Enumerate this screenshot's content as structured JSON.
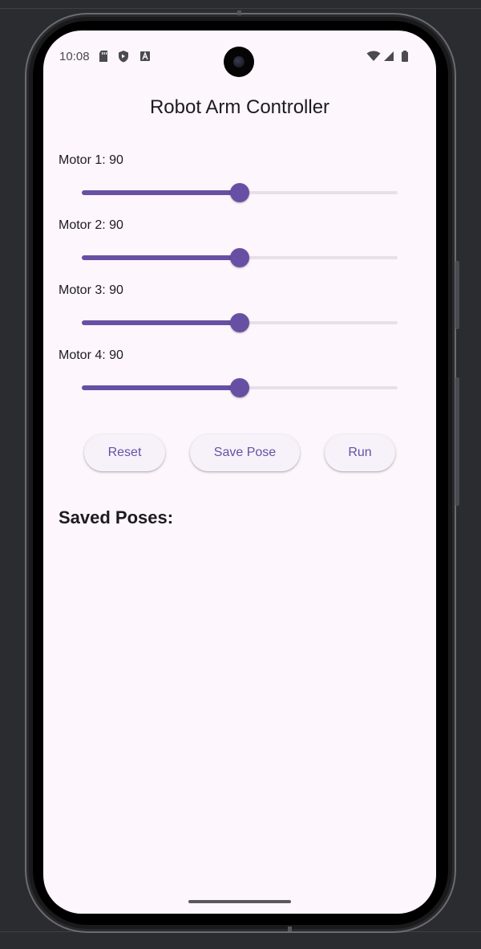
{
  "status_bar": {
    "time": "10:08",
    "left_icons": [
      "sd-card-icon",
      "shield-icon",
      "font-icon"
    ],
    "right_icons": [
      "wifi-icon",
      "signal-icon",
      "battery-icon"
    ]
  },
  "app": {
    "title": "Robot Arm Controller"
  },
  "motors": [
    {
      "label": "Motor 1: 90",
      "value": 90,
      "min": 0,
      "max": 180
    },
    {
      "label": "Motor 2: 90",
      "value": 90,
      "min": 0,
      "max": 180
    },
    {
      "label": "Motor 3: 90",
      "value": 90,
      "min": 0,
      "max": 180
    },
    {
      "label": "Motor 4: 90",
      "value": 90,
      "min": 0,
      "max": 180
    }
  ],
  "buttons": {
    "reset": "Reset",
    "save_pose": "Save Pose",
    "run": "Run"
  },
  "saved_poses": {
    "title": "Saved Poses:",
    "items": []
  },
  "colors": {
    "accent": "#6750a4",
    "screen_bg": "#fdf6fc",
    "track_inactive": "#e6e0e9",
    "button_bg": "#f7f2fa"
  }
}
